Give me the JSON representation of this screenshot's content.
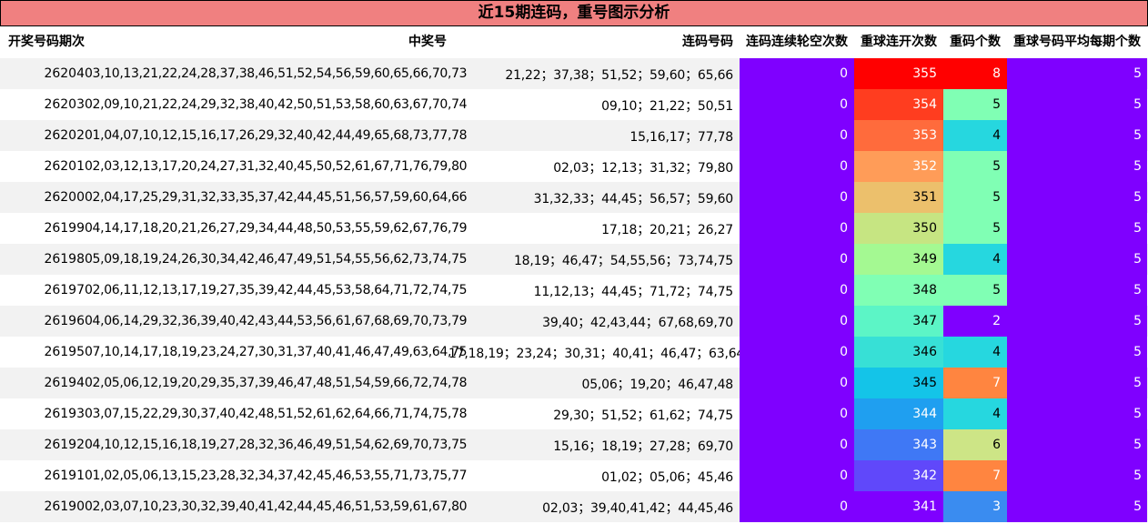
{
  "title": "近15期连码，重号图示分析",
  "headers": {
    "issue": "开奖号码期次",
    "numbers": "中奖号",
    "lian": "连码号码",
    "gap": "连码连续轮空次数",
    "chong": "重球连开次数",
    "count": "重码个数",
    "avg": "重球号码平均每期个数"
  },
  "colors": {
    "title_bg": "#f08080",
    "gap_bg": "#7f00ff",
    "avg_bg": "#7f00ff",
    "chong_bg": [
      "#ff0000",
      "#ff3d1f",
      "#ff6b3c",
      "#ff9c58",
      "#ecc06c",
      "#c6e582",
      "#a4f992",
      "#80ffb4",
      "#5cf5c6",
      "#37e0d6",
      "#14c4e8",
      "#1f9ff0",
      "#3f78f5",
      "#6048fa",
      "#7f00ff"
    ],
    "count_bg": {
      "2": "#7f00ff",
      "3": "#3a8cf0",
      "4": "#26d7df",
      "5": "#80ffb4",
      "6": "#cde586",
      "7": "#ff8540",
      "8": "#ff0000"
    }
  },
  "rows": [
    {
      "issue": "26204",
      "numbers": "03,10,13,21,22,24,28,37,38,46,51,52,54,56,59,60,65,66,70,73",
      "lian": "21,22；37,38；51,52；59,60；65,66",
      "gap": "0",
      "chong": "355",
      "count": "8",
      "avg": "5"
    },
    {
      "issue": "26203",
      "numbers": "02,09,10,21,22,24,29,32,38,40,42,50,51,53,58,60,63,67,70,74",
      "lian": "09,10；21,22；50,51",
      "gap": "0",
      "chong": "354",
      "count": "5",
      "avg": "5"
    },
    {
      "issue": "26202",
      "numbers": "01,04,07,10,12,15,16,17,26,29,32,40,42,44,49,65,68,73,77,78",
      "lian": "15,16,17；77,78",
      "gap": "0",
      "chong": "353",
      "count": "4",
      "avg": "5"
    },
    {
      "issue": "26201",
      "numbers": "02,03,12,13,17,20,24,27,31,32,40,45,50,52,61,67,71,76,79,80",
      "lian": "02,03；12,13；31,32；79,80",
      "gap": "0",
      "chong": "352",
      "count": "5",
      "avg": "5"
    },
    {
      "issue": "26200",
      "numbers": "02,04,17,25,29,31,32,33,35,37,42,44,45,51,56,57,59,60,64,66",
      "lian": "31,32,33；44,45；56,57；59,60",
      "gap": "0",
      "chong": "351",
      "count": "5",
      "avg": "5"
    },
    {
      "issue": "26199",
      "numbers": "04,14,17,18,20,21,26,27,29,34,44,48,50,53,55,59,62,67,76,79",
      "lian": "17,18；20,21；26,27",
      "gap": "0",
      "chong": "350",
      "count": "5",
      "avg": "5"
    },
    {
      "issue": "26198",
      "numbers": "05,09,18,19,24,26,30,34,42,46,47,49,51,54,55,56,62,73,74,75",
      "lian": "18,19；46,47；54,55,56；73,74,75",
      "gap": "0",
      "chong": "349",
      "count": "4",
      "avg": "5"
    },
    {
      "issue": "26197",
      "numbers": "02,06,11,12,13,17,19,27,35,39,42,44,45,53,58,64,71,72,74,75",
      "lian": "11,12,13；44,45；71,72；74,75",
      "gap": "0",
      "chong": "348",
      "count": "5",
      "avg": "5"
    },
    {
      "issue": "26196",
      "numbers": "04,06,14,29,32,36,39,40,42,43,44,53,56,61,67,68,69,70,73,79",
      "lian": "39,40；42,43,44；67,68,69,70",
      "gap": "0",
      "chong": "347",
      "count": "2",
      "avg": "5"
    },
    {
      "issue": "26195",
      "numbers": "07,10,14,17,18,19,23,24,27,30,31,37,40,41,46,47,49,63,64,75",
      "lian": "17,18,19；23,24；30,31；40,41；46,47；63,64",
      "gap": "0",
      "chong": "346",
      "count": "4",
      "avg": "5"
    },
    {
      "issue": "26194",
      "numbers": "02,05,06,12,19,20,29,35,37,39,46,47,48,51,54,59,66,72,74,78",
      "lian": "05,06；19,20；46,47,48",
      "gap": "0",
      "chong": "345",
      "count": "7",
      "avg": "5"
    },
    {
      "issue": "26193",
      "numbers": "03,07,15,22,29,30,37,40,42,48,51,52,61,62,64,66,71,74,75,78",
      "lian": "29,30；51,52；61,62；74,75",
      "gap": "0",
      "chong": "344",
      "count": "4",
      "avg": "5"
    },
    {
      "issue": "26192",
      "numbers": "04,10,12,15,16,18,19,27,28,32,36,46,49,51,54,62,69,70,73,75",
      "lian": "15,16；18,19；27,28；69,70",
      "gap": "0",
      "chong": "343",
      "count": "6",
      "avg": "5"
    },
    {
      "issue": "26191",
      "numbers": "01,02,05,06,13,15,23,28,32,34,37,42,45,46,53,55,71,73,75,77",
      "lian": "01,02；05,06；45,46",
      "gap": "0",
      "chong": "342",
      "count": "7",
      "avg": "5"
    },
    {
      "issue": "26190",
      "numbers": "02,03,07,10,23,30,32,39,40,41,42,44,45,46,51,53,59,61,67,80",
      "lian": "02,03；39,40,41,42；44,45,46",
      "gap": "0",
      "chong": "341",
      "count": "3",
      "avg": "5"
    }
  ]
}
